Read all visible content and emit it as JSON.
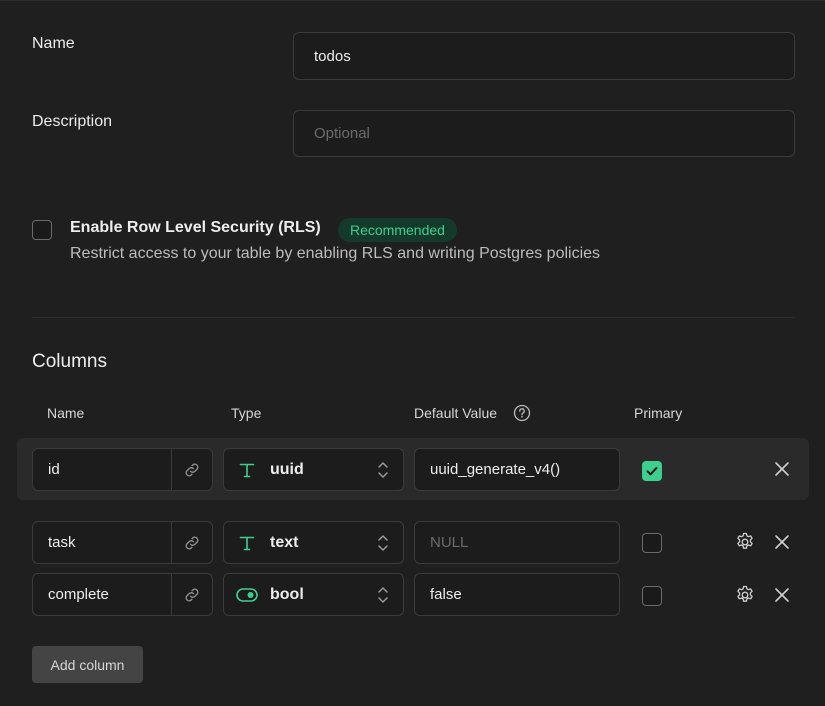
{
  "form": {
    "name_label": "Name",
    "name_value": "todos",
    "description_label": "Description",
    "description_placeholder": "Optional"
  },
  "rls": {
    "title": "Enable Row Level Security (RLS)",
    "badge": "Recommended",
    "description": "Restrict access to your table by enabling RLS and writing Postgres policies",
    "enabled": false
  },
  "columns": {
    "title": "Columns",
    "headers": {
      "name": "Name",
      "type": "Type",
      "default_value": "Default Value",
      "primary": "Primary"
    },
    "rows": [
      {
        "name": "id",
        "type": "uuid",
        "type_icon": "text-type-icon",
        "default_value": "uuid_generate_v4()",
        "default_is_placeholder": false,
        "primary": true
      },
      {
        "name": "task",
        "type": "text",
        "type_icon": "text-type-icon",
        "default_value": "NULL",
        "default_is_placeholder": true,
        "primary": false
      },
      {
        "name": "complete",
        "type": "bool",
        "type_icon": "toggle-type-icon",
        "default_value": "false",
        "default_is_placeholder": false,
        "primary": false
      }
    ],
    "add_button": "Add column"
  },
  "colors": {
    "background": "#1f1f1f",
    "accent": "#3ecf8e",
    "input_border": "#3b3b3b"
  }
}
